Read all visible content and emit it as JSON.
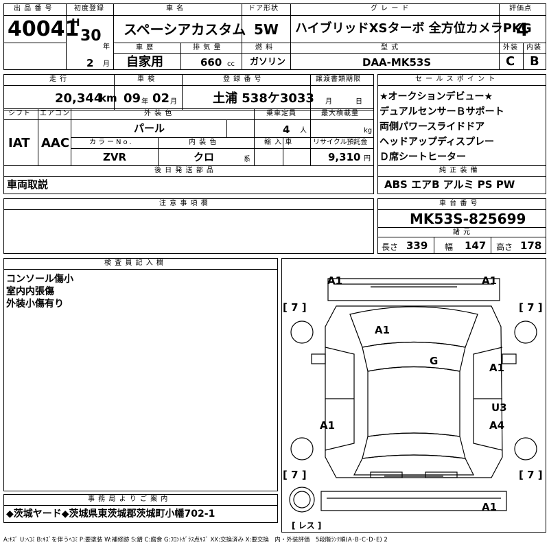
{
  "sheet": {
    "lot_label": "出 品 番 号",
    "lot_number": "40041",
    "first_reg_label": "初度登録",
    "era": "H",
    "year": "30",
    "year_unit": "年",
    "month": "2",
    "month_unit": "月",
    "car_name_label": "車 名",
    "car_name": "スペーシアカスタム",
    "door_label": "ドア形状",
    "door": "5W",
    "grade_label": "グ レ ー ド",
    "grade": "ハイブリッドXSターボ 全方位カメラPKG",
    "score_label": "評価点",
    "score": "4",
    "history_label": "車 歴",
    "history": "自家用",
    "displacement_label": "排 気 量",
    "displacement": "660",
    "displacement_unit": "cc",
    "fuel_label": "燃 料",
    "fuel": "ガソリン",
    "model_label": "型 式",
    "model": "DAA-MK53S",
    "ext_label": "外装",
    "int_label": "内装",
    "ext_grade": "C",
    "int_grade": "B",
    "mileage_label": "走 行",
    "mileage": "20,344",
    "mileage_unit": "km",
    "inspection_label": "車 検",
    "insp_year": "09",
    "insp_year_unit": "年",
    "insp_month": "02",
    "insp_month_unit": "月",
    "plate_label": "登 録 番 号",
    "plate": "土浦 538ケ3033",
    "transfer_label": "譲渡書類期限",
    "transfer_month": "月",
    "transfer_day": "日",
    "shift_label": "シフト",
    "shift": "IAT",
    "ac_label": "エアコン",
    "ac": "AAC",
    "color_label": "外 装 色",
    "color": "パール",
    "capacity_label": "乗車定員",
    "capacity": "4",
    "capacity_unit": "人",
    "load_label": "最大積載量",
    "load_unit": "kg",
    "color_no_label": "カラーNo.",
    "color_no": "ZVR",
    "int_color_label": "内 装 色",
    "int_color": "クロ",
    "int_color_unit": "系",
    "import_label": "輸 入 車",
    "recycle_label": "リサイクル預託金",
    "recycle": "9,310",
    "recycle_unit": "円",
    "later_parts_label": "後 日 発 送 部 品",
    "later_parts": "車両取説",
    "notes_label": "注 意 事 項 欄",
    "sales_label": "セ ー ル ス ポ イ ン ト",
    "sales_points": [
      "★オークションデビュー★",
      "デュアルセンサーＢサポート",
      "両側パワースライドドア",
      "ヘッドアップディスプレー",
      "Ｄ席シートヒーター"
    ],
    "equip_label": "純 正 装 備",
    "equipment": "ABS エアB アルミ PS PW",
    "chassis_label": "車 台 番 号",
    "chassis": "MK53S-825699",
    "dims_label": "諸 元",
    "length_label": "長さ",
    "length": "339",
    "width_label": "幅",
    "width": "147",
    "height_label": "高さ",
    "height": "178",
    "inspector_label": "検 査 員 記 入 欄",
    "inspector_notes": [
      "コンソール傷小",
      "室内内張傷",
      "外装小傷有り"
    ],
    "office_label": "事 務 局 よ り ご 案 内",
    "office_note": "◆茨城ヤード◆茨城県東茨城郡茨城町小幡702-1",
    "legend": "A:ｷｽﾞ U:ﾍｺﾐ B:ｷｽﾞを伴うﾍｺﾐ P:要塗装 W:補修跡 S:錆 C:腐食 G:ﾌﾛﾝﾄｶﾞﾗｽ点ｷｽﾞ XX:交換済み X:要交換　内・外装評価　5段階ﾗﾝｸ順(A･B･C･D･E) 2"
  },
  "diagram": {
    "tire_label": "[ 7 ]",
    "spare_label": "[ レス ]",
    "marks": [
      "A1",
      "A1",
      "A1",
      "G",
      "A1",
      "U3",
      "A1",
      "A4",
      "A1"
    ]
  }
}
